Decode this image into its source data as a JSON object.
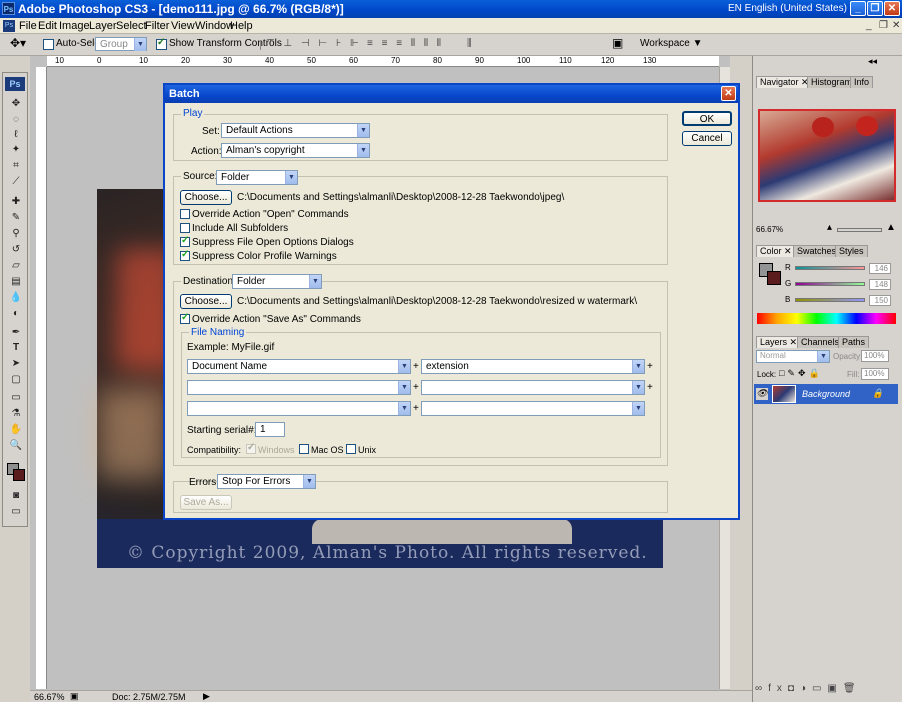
{
  "window": {
    "title": "Adobe Photoshop CS3 - [demo111.jpg @ 66.7% (RGB/8*)]",
    "language": "EN English (United States)",
    "controls": [
      "_",
      "❐",
      "✕"
    ]
  },
  "menu": [
    "File",
    "Edit",
    "Image",
    "Layer",
    "Select",
    "Filter",
    "View",
    "Window",
    "Help"
  ],
  "options_bar": {
    "auto_select_label": "Auto-Select:",
    "auto_select_value": "Group",
    "show_transform_label": "Show Transform Controls",
    "workspace_label": "Workspace ▼"
  },
  "rulers": {
    "h_ticks": [
      "10",
      "0",
      "10",
      "20",
      "30",
      "40",
      "50",
      "60",
      "70",
      "80",
      "90",
      "100",
      "110",
      "120",
      "130"
    ]
  },
  "canvas": {
    "watermark": "© Copyright 2009, Alman's Photo. All rights reserved."
  },
  "status": {
    "zoom": "66.67%",
    "doc": "Doc: 2.75M/2.75M"
  },
  "panels": {
    "navigator_tabs": [
      "Navigator",
      "Histogram",
      "Info"
    ],
    "navigator_zoom": "66.67%",
    "color_tabs": [
      "Color",
      "Swatches",
      "Styles"
    ],
    "color_values": {
      "R": "146",
      "G": "148",
      "B": "150"
    },
    "layers_tabs": [
      "Layers",
      "Channels",
      "Paths"
    ],
    "blend_mode": "Normal",
    "opacity_label": "Opacity:",
    "opacity": "100%",
    "lock_label": "Lock:",
    "fill_label": "Fill:",
    "fill": "100%",
    "layer_name": "Background"
  },
  "batch": {
    "title": "Batch",
    "ok": "OK",
    "cancel": "Cancel",
    "play": {
      "group": "Play",
      "set_label": "Set:",
      "set_value": "Default Actions",
      "action_label": "Action:",
      "action_value": "Alman's copyright"
    },
    "source": {
      "label": "Source:",
      "value": "Folder",
      "choose": "Choose...",
      "path": "C:\\Documents and Settings\\almanli\\Desktop\\2008-12-28 Taekwondo\\jpeg\\",
      "checks": [
        {
          "label": "Override Action \"Open\" Commands",
          "checked": false
        },
        {
          "label": "Include All Subfolders",
          "checked": false
        },
        {
          "label": "Suppress File Open Options Dialogs",
          "checked": true
        },
        {
          "label": "Suppress Color Profile Warnings",
          "checked": true
        }
      ]
    },
    "destination": {
      "label": "Destination:",
      "value": "Folder",
      "choose": "Choose...",
      "path": "C:\\Documents and Settings\\almanli\\Desktop\\2008-12-28 Taekwondo\\resized w watermark\\",
      "override_label": "Override Action \"Save As\" Commands",
      "override_checked": true
    },
    "file_naming": {
      "group": "File Naming",
      "example": "Example: MyFile.gif",
      "rows": [
        [
          "Document Name",
          "extension"
        ],
        [
          "",
          ""
        ],
        [
          "",
          ""
        ]
      ],
      "serial_label": "Starting serial#:",
      "serial_value": "1",
      "compat_label": "Compatibility:",
      "compat": [
        {
          "label": "Windows",
          "checked": true,
          "disabled": true
        },
        {
          "label": "Mac OS",
          "checked": false,
          "disabled": false
        },
        {
          "label": "Unix",
          "checked": false,
          "disabled": false
        }
      ]
    },
    "errors": {
      "label": "Errors:",
      "value": "Stop For Errors",
      "save_as": "Save As..."
    }
  }
}
